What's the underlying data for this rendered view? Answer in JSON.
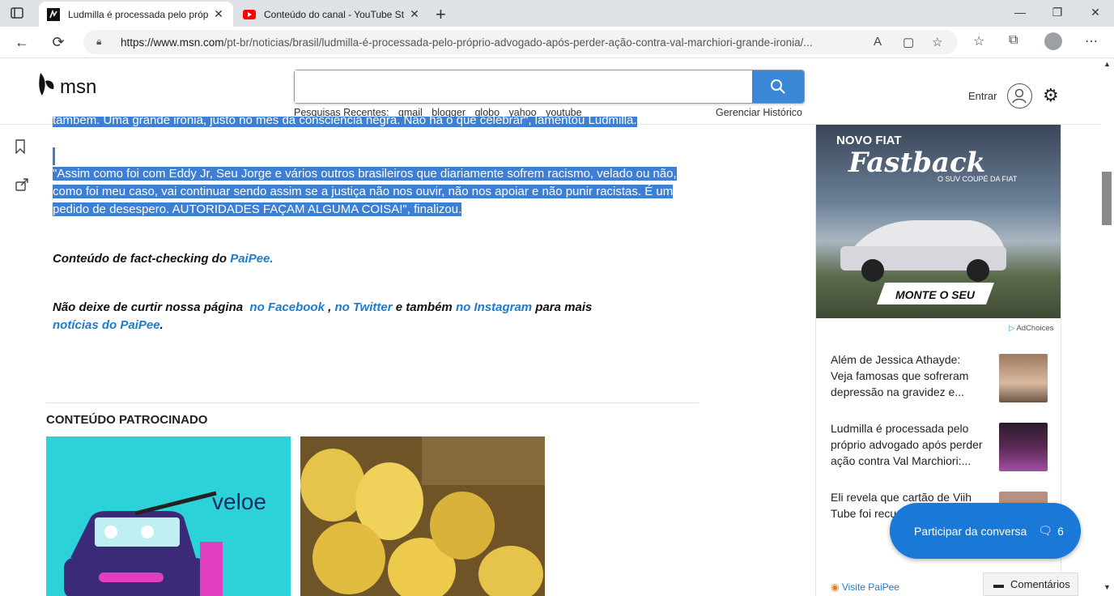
{
  "browser": {
    "tabs": [
      {
        "title": "Ludmilla é processada pelo próp",
        "active": true
      },
      {
        "title": "Conteúdo do canal - YouTube St",
        "active": false
      }
    ],
    "url_domain": "https://www.msn.com",
    "url_path": "/pt-br/noticias/brasil/ludmilla-é-processada-pelo-próprio-advogado-após-perder-ação-contra-val-marchiori-grande-ironia/..."
  },
  "header": {
    "logo": "msn",
    "search_placeholder": "",
    "recent_label": "Pesquisas Recentes:",
    "recent": [
      "gmail",
      "blogger",
      "globo",
      "yahoo",
      "youtube"
    ],
    "manage_history": "Gerenciar Histórico",
    "signin": "Entrar"
  },
  "article": {
    "top_cut": "também. Uma grande ironia, justo no mês da consciência negra. Não há o que celebrar\", lamentou Ludmilla.",
    "quote": "\"Assim como foi com Eddy Jr, Seu Jorge e vários outros brasileiros que diariamente sofrem racismo, velado ou não, como foi meu caso, vai continuar sendo assim se a justiça não nos ouvir, não nos apoiar e não punir racistas. É um pedido de desespero. AUTORIDADES FAÇAM ALGUMA COISA!\", finalizou.",
    "fact_prefix": "Conteúdo de fact-checking do",
    "fact_link": "PaiPee.",
    "follow_1": "Não deixe de curtir nossa página",
    "follow_fb": "no Facebook",
    "follow_sep": ",",
    "follow_tw": "no Twitter",
    "follow_mid": "e também",
    "follow_ig": "no Instagram",
    "follow_2": "para mais",
    "follow_news": "notícias do PaiPee",
    "follow_end": "."
  },
  "sponsored": {
    "heading": "CONTEÚDO PATROCINADO",
    "card1_brand": "veloe"
  },
  "ad": {
    "line1": "NOVO FIAT",
    "line2": "Fastback",
    "line3": "O SUV COUPÉ DA FIAT",
    "cta": "MONTE O SEU",
    "adchoices": "AdChoices"
  },
  "sidebar": {
    "items": [
      {
        "title": "Além de Jessica Athayde: Veja famosas que sofreram depressão na gravidez e..."
      },
      {
        "title": "Ludmilla é processada pelo próprio advogado após perder ação contra Val Marchiori:..."
      },
      {
        "title": "Eli revela que cartão de Viih Tube foi recu... Nova York:..."
      }
    ],
    "fab_label": "Participar da conversa",
    "fab_count": "6",
    "comments": "Comentários",
    "visit": "Visite PaiPee"
  }
}
